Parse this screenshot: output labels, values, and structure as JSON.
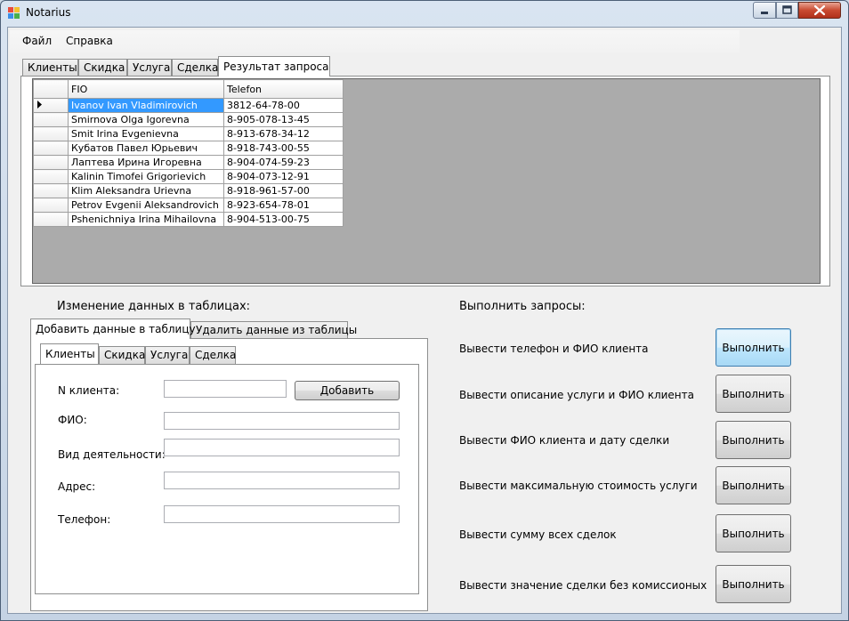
{
  "window": {
    "title": "Notarius"
  },
  "menu": [
    "Файл",
    "Справка"
  ],
  "main_tabs": [
    {
      "label": "Клиенты"
    },
    {
      "label": "Скидка"
    },
    {
      "label": "Услуга"
    },
    {
      "label": "Сделка"
    },
    {
      "label": "Результат запроса",
      "active": true
    }
  ],
  "grid": {
    "columns": [
      "FIO",
      "Telefon"
    ],
    "rows": [
      {
        "fio": "Ivanov Ivan Vladimirovich",
        "tel": "3812-64-78-00",
        "selected": true
      },
      {
        "fio": "Smirnova Olga Igorevna",
        "tel": "8-905-078-13-45"
      },
      {
        "fio": "Smit Irina Evgenievna",
        "tel": "8-913-678-34-12"
      },
      {
        "fio": "Кубатов Павел Юрьевич",
        "tel": "8-918-743-00-55"
      },
      {
        "fio": "Лаптева Ирина Игоревна",
        "tel": "8-904-074-59-23"
      },
      {
        "fio": "Kalinin Timofei Grigorievich",
        "tel": "8-904-073-12-91"
      },
      {
        "fio": "Klim Aleksandra Urievna",
        "tel": "8-918-961-57-00"
      },
      {
        "fio": "Petrov Evgenii Aleksandrovich",
        "tel": "8-923-654-78-01"
      },
      {
        "fio": "Pshenichniya Irina Mihailovna",
        "tel": "8-904-513-00-75"
      }
    ]
  },
  "edit_section": {
    "title": "Изменение данных в таблицах:",
    "tabs": [
      "Добавить данные в таблицу",
      "Удалить данные из таблицы"
    ],
    "sub_tabs": [
      "Клиенты",
      "Скидка",
      "Услуга",
      "Сделка"
    ],
    "fields": [
      {
        "label": "N клиента:",
        "value": ""
      },
      {
        "label": "ФИО:",
        "value": ""
      },
      {
        "label": "Вид деятельности:",
        "value": ""
      },
      {
        "label": "Адрес:",
        "value": ""
      },
      {
        "label": "Телефон:",
        "value": ""
      }
    ],
    "add_button": "Добавить"
  },
  "query_section": {
    "title": "Выполнить запросы:",
    "queries": [
      {
        "label": "Вывести телефон и ФИО клиента",
        "button": "Выполнить"
      },
      {
        "label": "Вывести описание услуги и ФИО клиента",
        "button": "Выполнить"
      },
      {
        "label": "Вывести ФИО клиента и дату сделки",
        "button": "Выполнить"
      },
      {
        "label": "Вывести максимальную стоимость услуги",
        "button": "Выполнить"
      },
      {
        "label": "Вывести сумму всех сделок",
        "button": "Выполнить"
      },
      {
        "label": "Вывести значение сделки без комиссионых",
        "button": "Выполнить"
      }
    ]
  },
  "colors": {
    "selection": "#3399ff",
    "grid_background": "#ababab",
    "client_background": "#f0f0f0"
  }
}
